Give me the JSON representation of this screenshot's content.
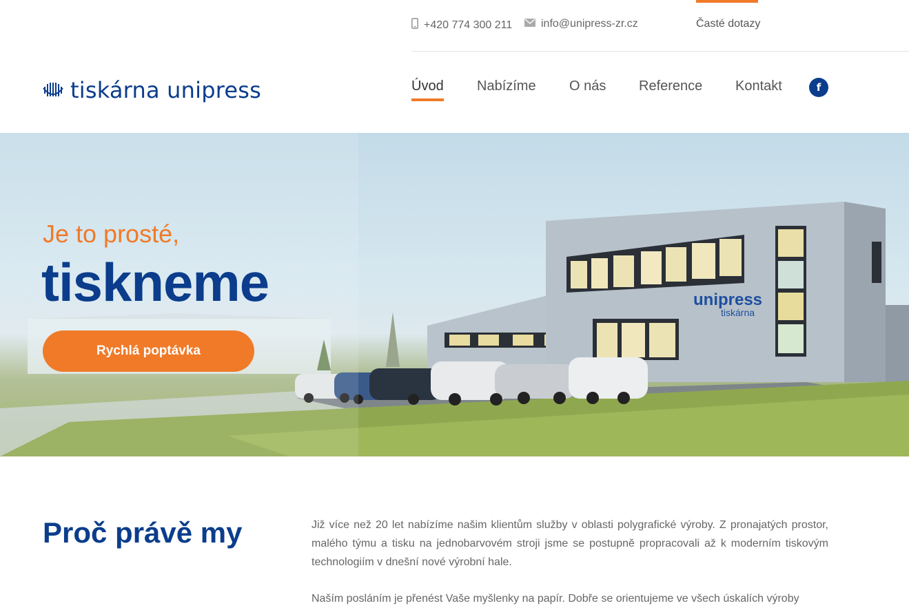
{
  "topbar": {
    "phone": "+420 774 300 211",
    "email": "info@unipress-zr.cz",
    "faq": "Časté dotazy"
  },
  "header": {
    "logo_text": "tiskárna unipress",
    "nav": [
      {
        "label": "Úvod",
        "active": true
      },
      {
        "label": "Nabízíme",
        "active": false
      },
      {
        "label": "O nás",
        "active": false
      },
      {
        "label": "Reference",
        "active": false
      },
      {
        "label": "Kontakt",
        "active": false
      }
    ],
    "social_icon": "facebook-icon"
  },
  "hero": {
    "subtitle": "Je to prosté,",
    "title": "tiskneme",
    "cta": "Rychlá poptávka",
    "building_sign": "unipress",
    "building_sign_sub": "tiskárna"
  },
  "about": {
    "heading": "Proč právě my",
    "paragraphs": [
      "Již více než 20 let nabízíme našim klientům služby v oblasti polygrafické výroby.  Z pronajatých prostor, malého týmu a tisku na jednobarvovém stroji jsme se postupně propracovali až k moderním tiskovým technologiím v dnešní nové výrobní hale.",
      "Naším posláním je přenést Vaše myšlenky na papír. Dobře se orientujeme ve všech úskalích výroby"
    ]
  },
  "colors": {
    "brand_blue": "#0b3d8c",
    "accent_orange": "#f07a28"
  }
}
